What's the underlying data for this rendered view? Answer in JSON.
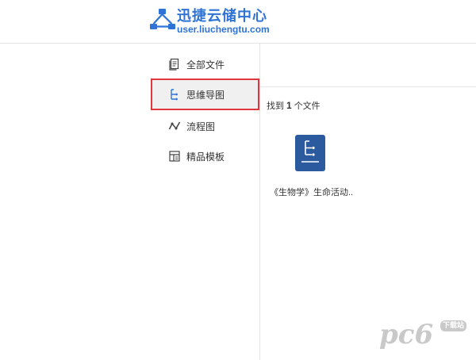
{
  "brand": {
    "title": "迅捷云储中心",
    "url": "user.liuchengtu.com",
    "logo_icon": "network-logo-icon",
    "color": "#2f73d6"
  },
  "sidebar": {
    "items": [
      {
        "label": "全部文件",
        "icon": "document-icon",
        "active": false
      },
      {
        "label": "思维导图",
        "icon": "mindmap-icon",
        "active": true
      },
      {
        "label": "流程图",
        "icon": "flowchart-icon",
        "active": false
      },
      {
        "label": "精品模板",
        "icon": "template-icon",
        "active": false
      }
    ],
    "active_border_color": "#e0363c"
  },
  "main": {
    "count_prefix": "找到",
    "count_value": "1",
    "count_suffix": "个文件",
    "files": [
      {
        "name": "《生物学》生命活动..",
        "icon": "mindmap-file-icon",
        "icon_color": "#2b5a9e"
      }
    ]
  },
  "watermark": {
    "text": "pc6",
    "sub": "下载站"
  }
}
